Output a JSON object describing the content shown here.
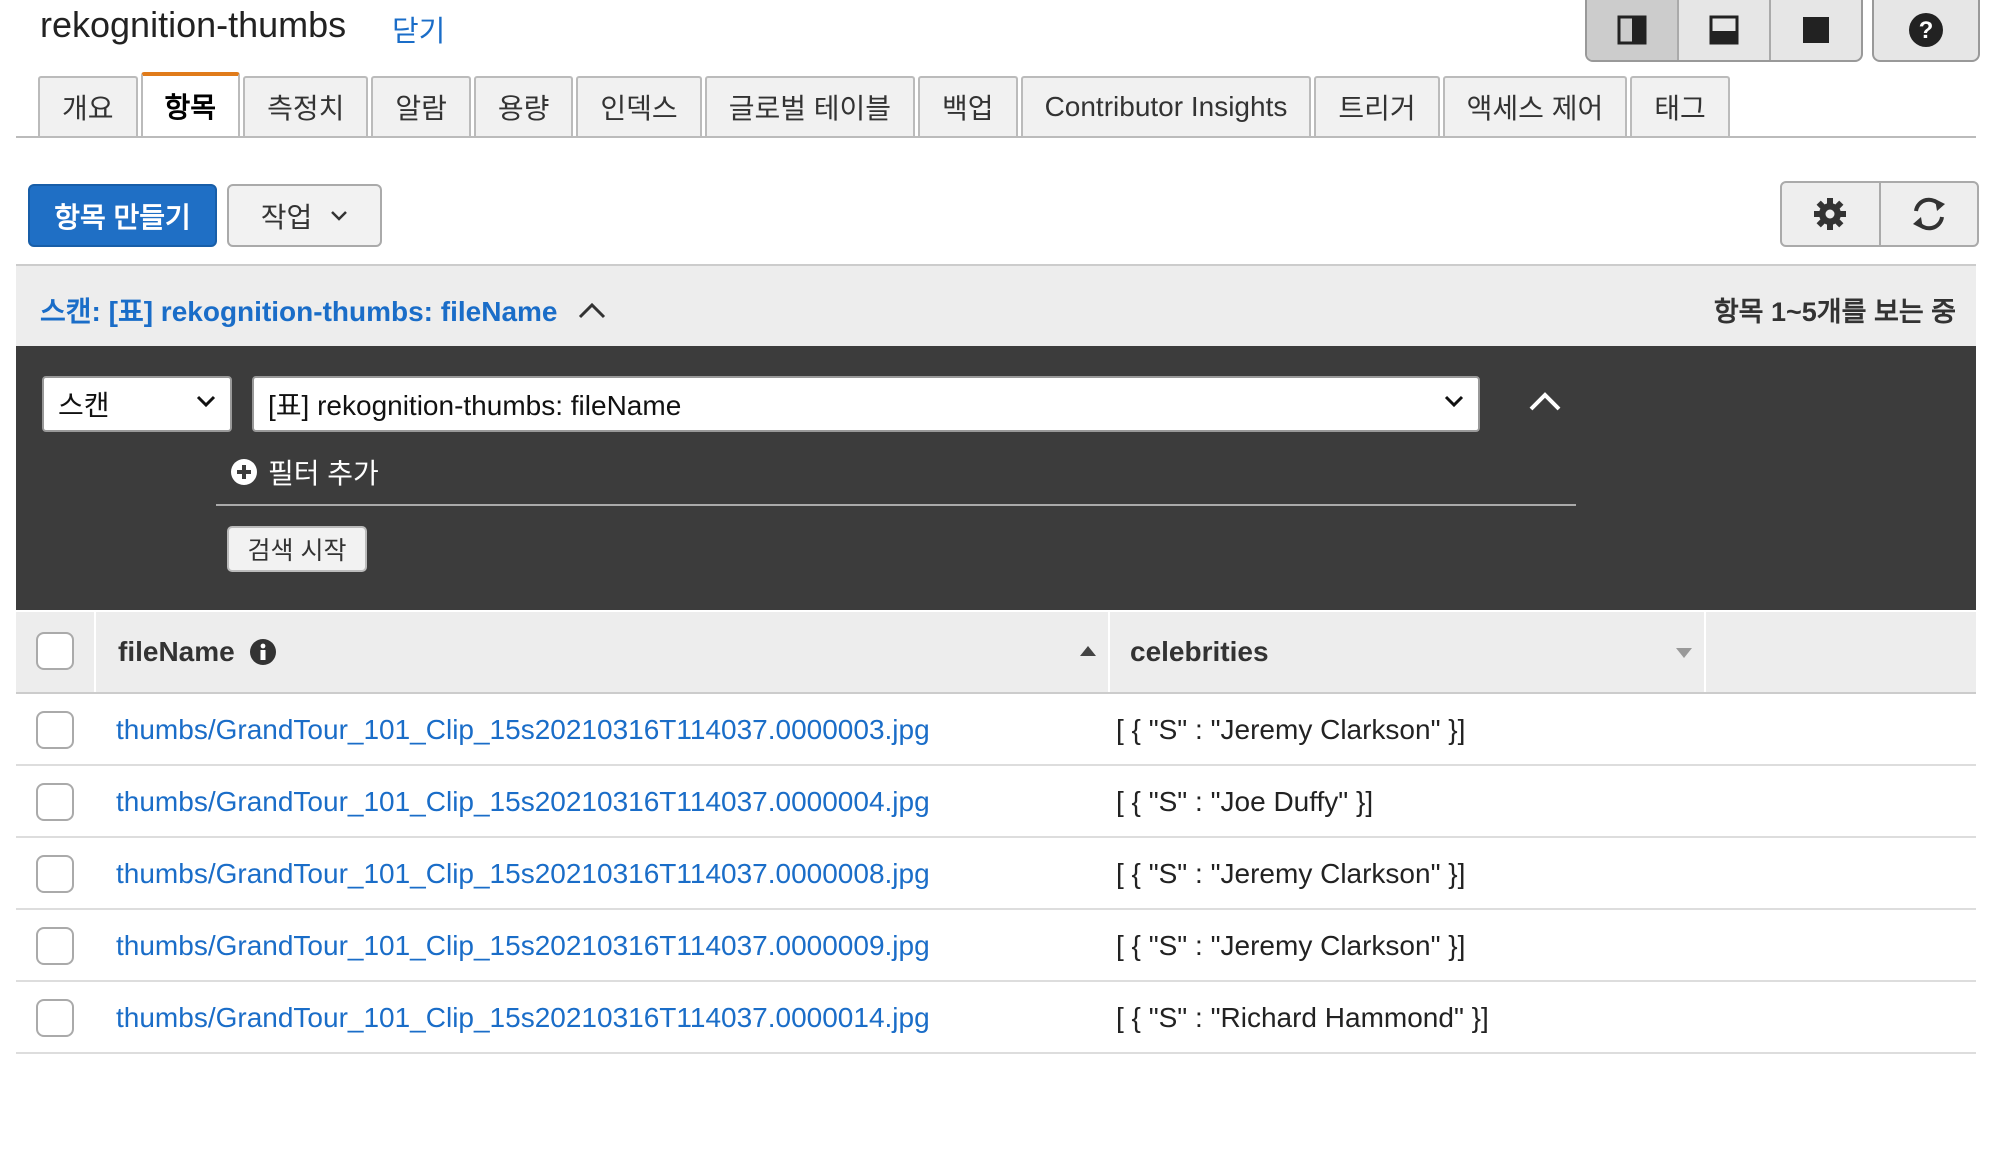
{
  "header": {
    "title": "rekognition-thumbs",
    "close_label": "닫기"
  },
  "tabs": [
    {
      "label": "개요",
      "active": false
    },
    {
      "label": "항목",
      "active": true
    },
    {
      "label": "측정치",
      "active": false
    },
    {
      "label": "알람",
      "active": false
    },
    {
      "label": "용량",
      "active": false
    },
    {
      "label": "인덱스",
      "active": false
    },
    {
      "label": "글로벌 테이블",
      "active": false
    },
    {
      "label": "백업",
      "active": false
    },
    {
      "label": "Contributor Insights",
      "active": false
    },
    {
      "label": "트리거",
      "active": false
    },
    {
      "label": "액세스 제어",
      "active": false
    },
    {
      "label": "태그",
      "active": false
    }
  ],
  "toolbar": {
    "create_label": "항목 만들기",
    "actions_label": "작업"
  },
  "scan": {
    "title": "스캔: [표] rekognition-thumbs: fileName",
    "count_text": "항목 1~5개를 보는 중",
    "type_selected": "스캔",
    "index_selected": "[표] rekognition-thumbs: fileName",
    "add_filter_label": "필터 추가",
    "start_search_label": "검색 시작"
  },
  "table": {
    "columns": [
      "fileName",
      "celebrities"
    ],
    "rows": [
      {
        "fileName": "thumbs/GrandTour_101_Clip_15s20210316T114037.0000003.jpg",
        "celebrities": "[ { \"S\" : \"Jeremy Clarkson\" }]"
      },
      {
        "fileName": "thumbs/GrandTour_101_Clip_15s20210316T114037.0000004.jpg",
        "celebrities": "[ { \"S\" : \"Joe Duffy\" }]"
      },
      {
        "fileName": "thumbs/GrandTour_101_Clip_15s20210316T114037.0000008.jpg",
        "celebrities": "[ { \"S\" : \"Jeremy Clarkson\" }]"
      },
      {
        "fileName": "thumbs/GrandTour_101_Clip_15s20210316T114037.0000009.jpg",
        "celebrities": "[ { \"S\" : \"Jeremy Clarkson\" }]"
      },
      {
        "fileName": "thumbs/GrandTour_101_Clip_15s20210316T114037.0000014.jpg",
        "celebrities": "[ { \"S\" : \"Richard Hammond\" }]"
      }
    ]
  },
  "colors": {
    "primary": "#1f6fc5",
    "link": "#1a6dc8",
    "tab_accent": "#e07b1a",
    "panel_bg": "#3c3c3c"
  }
}
